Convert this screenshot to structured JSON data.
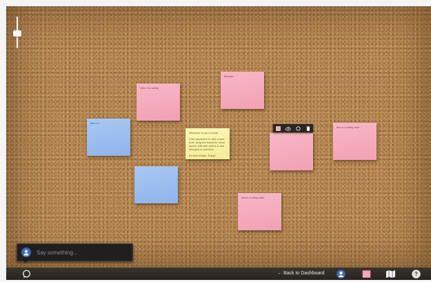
{
  "board": {
    "zoom_level": 0.55
  },
  "notes": [
    {
      "color": "pink",
      "text": "Here it is totally"
    },
    {
      "color": "pink",
      "text": "Beware"
    },
    {
      "color": "blue",
      "text": "this is it"
    },
    {
      "color": "blue",
      "text": ""
    },
    {
      "color": "yellow",
      "lines": [
        "Welcome to your board!",
        "Click anywhere to add a new note, drag the board for more space, edit with others & see changes in real time.",
        "It's that simple. Enjoy!"
      ]
    },
    {
      "color": "pink",
      "text": ""
    },
    {
      "color": "pink",
      "text": "this is a sticky note"
    },
    {
      "color": "pink",
      "text": "this is a sticky also"
    }
  ],
  "note_toolbar": {
    "icons": [
      "color-swatch-icon",
      "cloud-upload-icon",
      "circle-icon",
      "trash-icon"
    ]
  },
  "chat": {
    "placeholder": "Say something..."
  },
  "bottom_bar": {
    "back_label": "← Back to Dashboard",
    "help_label": "?"
  },
  "colors": {
    "pink": "#f3a8b9",
    "blue": "#99bbee",
    "yellow": "#f7f2a6",
    "bar": "#2b2621"
  }
}
